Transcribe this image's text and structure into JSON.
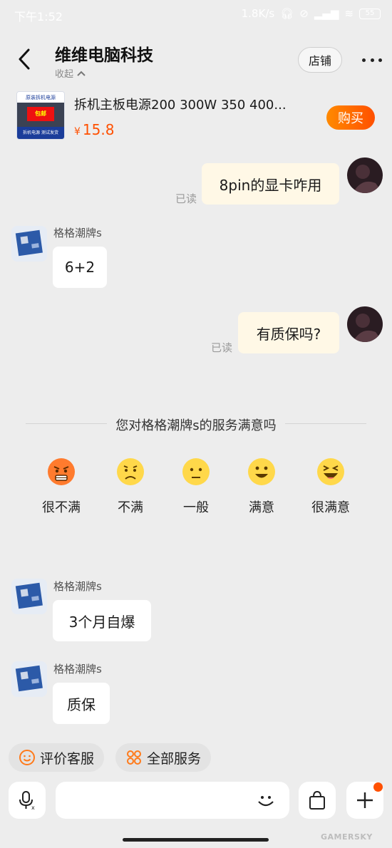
{
  "status_bar": {
    "time": "下午1:52",
    "net_speed": "1.8K/s",
    "battery": "55"
  },
  "header": {
    "shop_name": "维维电脑科技",
    "collapse_label": "收起",
    "store_button": "店铺"
  },
  "product": {
    "thumb_texts": [
      "原装拆机电源",
      "包邮",
      "拆机电源 测试发货"
    ],
    "name": "拆机主板电源200 300W 350 400...",
    "currency": "¥",
    "price": "15.8",
    "buy_label": "购买"
  },
  "messages": {
    "m1": {
      "text": "8pin的显卡咋用",
      "read": "已读"
    },
    "m2": {
      "sender": "格格潮牌s",
      "text": "6+2"
    },
    "m3": {
      "text": "有质保吗?",
      "read": "已读"
    },
    "m4": {
      "sender": "格格潮牌s",
      "text": "3个月自爆"
    },
    "m5": {
      "sender": "格格潮牌s",
      "text": "质保"
    }
  },
  "survey": {
    "title": "您对格格潮牌s的服务满意吗",
    "options": [
      "很不满",
      "不满",
      "一般",
      "满意",
      "很满意"
    ]
  },
  "quick_actions": {
    "rate_service": "评价客服",
    "all_services": "全部服务"
  },
  "watermark": "GAMERSKY",
  "colors": {
    "accent": "#ff5000",
    "background": "#ededed",
    "my_bubble": "#fff8e6"
  }
}
